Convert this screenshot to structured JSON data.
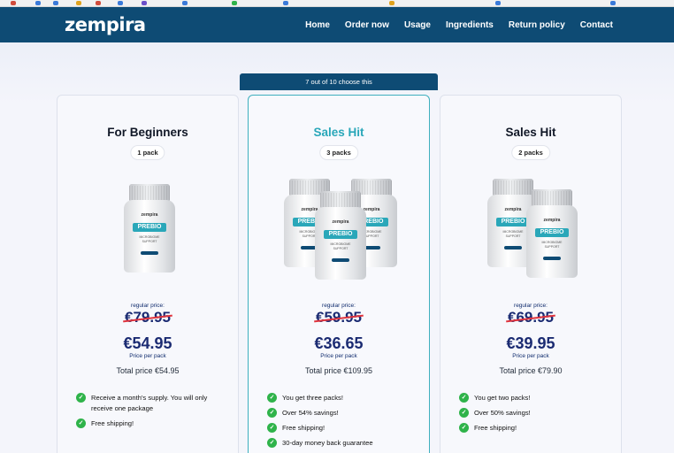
{
  "brand": {
    "name": "zempira"
  },
  "nav": {
    "items": [
      "Home",
      "Order now",
      "Usage",
      "Ingredients",
      "Return policy",
      "Contact"
    ]
  },
  "banner": {
    "text": "7 out of 10 choose this"
  },
  "bottle_label": {
    "brand": "zempira",
    "product_pre": "PRE",
    "product_bio": "BIO",
    "subtitle_line1": "MICROBIOME",
    "subtitle_line2": "SUPPORT"
  },
  "cards": [
    {
      "title": "For Beginners",
      "packs": "1 pack",
      "regular_label": "regular price:",
      "old_price": "€79.95",
      "new_price": "€54.95",
      "per_pack": "Price per pack",
      "total": "Total price €54.95",
      "features": [
        "Receive a month's supply. You will only receive one package",
        "Free shipping!"
      ]
    },
    {
      "title": "Sales Hit",
      "packs": "3 packs",
      "regular_label": "regular price:",
      "old_price": "€59.95",
      "new_price": "€36.65",
      "per_pack": "Price per pack",
      "total": "Total price €109.95",
      "features": [
        "You get three packs!",
        "Over 54% savings!",
        "Free shipping!",
        "30-day money back guarantee"
      ]
    },
    {
      "title": "Sales Hit",
      "packs": "2 packs",
      "regular_label": "regular price:",
      "old_price": "€69.95",
      "new_price": "€39.95",
      "per_pack": "Price per pack",
      "total": "Total price €79.90",
      "features": [
        "You get two packs!",
        "Over 50% savings!",
        "Free shipping!"
      ]
    }
  ],
  "colors": {
    "nav": "#0e4b74",
    "accent": "#2aa7b9",
    "price": "#1b2b72",
    "strike": "#e0343e",
    "check": "#2fb34a"
  },
  "icons": {
    "feature": "check-icon"
  }
}
